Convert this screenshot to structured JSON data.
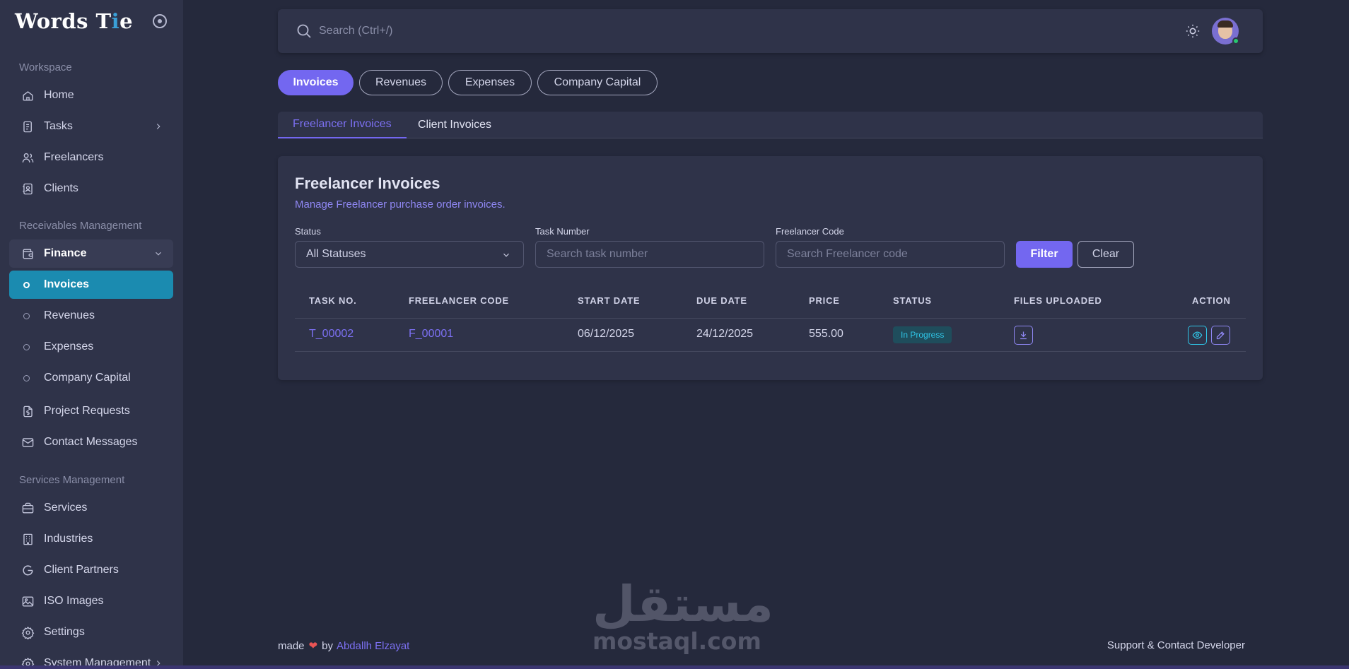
{
  "brand": {
    "name_start": "Words T",
    "name_accent": "i",
    "name_end": "e"
  },
  "sidebar": {
    "sections": {
      "workspace": "Workspace",
      "receivables": "Receivables Management",
      "services": "Services Management"
    },
    "items": {
      "home": "Home",
      "tasks": "Tasks",
      "freelancers": "Freelancers",
      "clients": "Clients",
      "finance": "Finance",
      "invoices": "Invoices",
      "revenues": "Revenues",
      "expenses": "Expenses",
      "company_capital": "Company Capital",
      "project_requests": "Project Requests",
      "contact_messages": "Contact Messages",
      "services": "Services",
      "industries": "Industries",
      "client_partners": "Client Partners",
      "iso_images": "ISO Images",
      "settings": "Settings",
      "system_management": "System Management"
    }
  },
  "topbar": {
    "search_placeholder": "Search (Ctrl+/)"
  },
  "finance_tabs": [
    "Invoices",
    "Revenues",
    "Expenses",
    "Company Capital"
  ],
  "invoice_tabs": [
    "Freelancer Invoices",
    "Client Invoices"
  ],
  "card": {
    "title": "Freelancer Invoices",
    "subtitle": "Manage Freelancer purchase order invoices.",
    "filters": {
      "status_label": "Status",
      "status_value": "All Statuses",
      "task_label": "Task Number",
      "task_placeholder": "Search task number",
      "freelancer_label": "Freelancer Code",
      "freelancer_placeholder": "Search Freelancer code",
      "filter_button": "Filter",
      "clear_button": "Clear"
    },
    "table": {
      "headers": [
        "TASK NO.",
        "FREELANCER CODE",
        "START DATE",
        "DUE DATE",
        "PRICE",
        "STATUS",
        "FILES UPLOADED",
        "ACTION"
      ],
      "rows": [
        {
          "task_no": "T_00002",
          "freelancer_code": "F_00001",
          "start_date": "06/12/2025",
          "due_date": "24/12/2025",
          "price": "555.00",
          "status": "In Progress"
        }
      ]
    }
  },
  "footer": {
    "made": "made",
    "by": "by",
    "author": "Abdallh Elzayat",
    "support": "Support & Contact Developer"
  },
  "watermark": {
    "arabic": "مستقل",
    "latin": "mostaql.com"
  },
  "colors": {
    "primary": "#7367f0",
    "active_nav": "#1b8bb0",
    "info": "#2fc6e8",
    "heart": "#ea5455",
    "online": "#28c76f"
  }
}
